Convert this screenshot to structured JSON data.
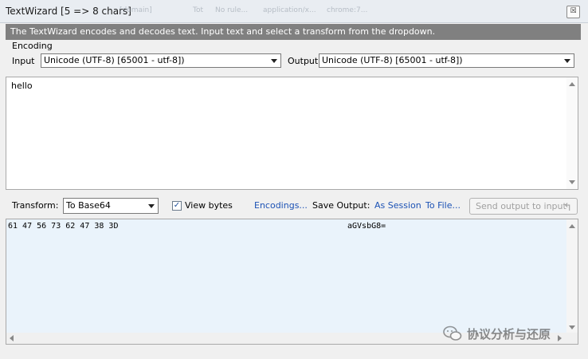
{
  "window": {
    "title": "TextWizard [5 => 8 chars]",
    "close_glyph": "☒",
    "background_tabs": [
      "[domain]",
      "Tot",
      "No rule...",
      "application/x...",
      "chrome:7..."
    ]
  },
  "info_bar": {
    "text": "The TextWizard encodes and decodes text. Input text and select a transform from the dropdown."
  },
  "encoding": {
    "group_label": "Encoding",
    "input_label": "Input",
    "input_value": "Unicode (UTF-8) [65001 - utf-8])",
    "output_label": "Output",
    "output_value": "Unicode (UTF-8) [65001 - utf-8])"
  },
  "input_text": "hello",
  "toolbar": {
    "transform_label": "Transform:",
    "transform_value": "To Base64",
    "view_bytes_label": "View bytes",
    "view_bytes_checked": true,
    "encodings_link": "Encodings...",
    "save_output_label": "Save Output:",
    "as_session_link": "As Session",
    "to_file_link": "To File...",
    "send_button": "Send output to input"
  },
  "output": {
    "hex_bytes": "61 47 56 73 62 47 38 3D",
    "text": "aGVsbG8="
  },
  "watermark": {
    "text": "协议分析与还原"
  },
  "colors": {
    "info_bar_bg": "#808080",
    "link": "#1c52b5",
    "output_bg": "#eaf3fb"
  }
}
